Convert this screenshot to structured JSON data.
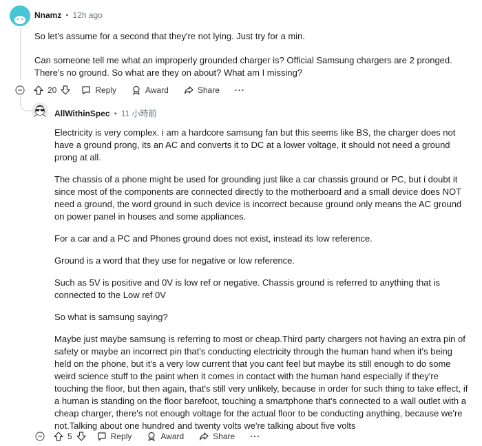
{
  "comment": {
    "author": "Nnamz",
    "separator": "•",
    "time": "12h ago",
    "paragraphs": [
      "So let's assume for a second that they're not lying. Just try for a min.",
      "Can someone tell me what an improperly grounded charger is? Official Samsung chargers are 2 pronged. There's no ground. So what are they on about? What am I missing?"
    ],
    "votes": "20",
    "reply_label": "Reply",
    "award_label": "Award",
    "share_label": "Share",
    "more_label": "···"
  },
  "reply": {
    "author": "AllWithinSpec",
    "separator": "•",
    "time": "11 小時前",
    "paragraphs": [
      "Electricity is very complex. i am a hardcore samsung fan but this seems like BS, the charger does not have a ground prong, its an AC and converts it to DC at a lower voltage, it should not need a ground prong at all.",
      "The chassis of a phone might be used for grounding just like a car chassis ground or PC, but i doubt it since most of the components are connected directly to the motherboard and a small device does NOT need a ground, the word ground in such device is incorrect because ground only means the AC ground on power panel in houses and some appliances.",
      "For a car and a PC and Phones ground does not exist, instead its low reference.",
      "Ground is a word that they use for negative or low reference.",
      "Such as 5V is positive and 0V is low ref or negative. Chassis ground is referred to anything that is connected to the Low ref 0V",
      "So what is samsung saying?",
      "Maybe just maybe samsung is referring to most or cheap.Third party chargers not having an extra pin of safety or maybe an incorrect pin that's conducting electricity through the human hand when it's being held on the phone, but it's a very low current that you cant feel but maybe its still enough to do some weird science stuff to the paint when it comes in contact with the human hand especially if they're touching the floor, but then again, that's still very unlikely, because in order for such thing to take effect, if a human is standing on the floor barefoot, touching a smartphone that's connected to a wall outlet with a cheap charger, there's not enough voltage for the actual floor to be conducting anything, because we're not.Talking about one hundred and twenty volts we're talking about five volts"
    ],
    "votes": "5",
    "reply_label": "Reply",
    "award_label": "Award",
    "share_label": "Share",
    "more_label": "···"
  },
  "colors": {
    "avatar_teal": "#46c6d6",
    "thread_line": "#d4d7d9",
    "meta_gray": "#6b7a80"
  },
  "icons": [
    "collapse-icon",
    "upvote-icon",
    "downvote-icon",
    "comment-icon",
    "award-icon",
    "share-icon",
    "more-icon"
  ]
}
